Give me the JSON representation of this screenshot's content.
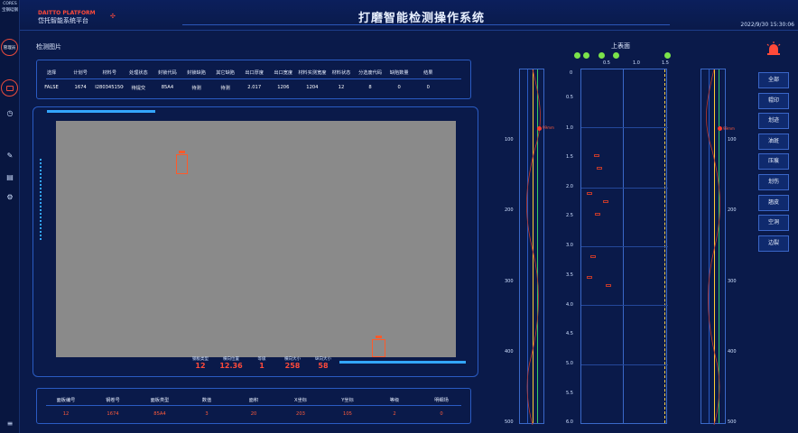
{
  "left_rail": {
    "logo_top": "CORES",
    "logo_bottom": "宝钢硅钢",
    "active_label": "管理员"
  },
  "header": {
    "brand_en": "DAITTO PLATFORM",
    "brand_cn": "岱托智能系统平台",
    "title": "打磨智能检测操作系统",
    "clock": "2022/9/30 15:30:06"
  },
  "image_section": {
    "title": "检测图片"
  },
  "material_table": {
    "columns": [
      "选择",
      "计划号",
      "材料号",
      "处理状态",
      "封锁代码",
      "封锁缺陷",
      "其它缺陷",
      "出口厚度",
      "出口宽度",
      "材料实测宽度",
      "材料状态",
      "分选废代码",
      "缺陷数量",
      "结果"
    ],
    "row": [
      "FALSE",
      "1674",
      "I2803451500",
      "待提交",
      "85A4",
      "待测",
      "待测",
      "2.017",
      "1206",
      "1204",
      "12",
      "8",
      "0",
      "0"
    ]
  },
  "readout": {
    "items": [
      {
        "label": "钢板类型",
        "value": "12"
      },
      {
        "label": "横向位置",
        "value": "12.36"
      },
      {
        "label": "等级",
        "value": "1"
      },
      {
        "label": "横向大小",
        "value": "258"
      },
      {
        "label": "纵向大小",
        "value": "58"
      }
    ]
  },
  "defect_table": {
    "columns": [
      "面板编号",
      "钢卷号",
      "面板类型",
      "数值",
      "面积",
      "X坐标",
      "Y坐标",
      "等级",
      "明细场"
    ],
    "row": [
      "12",
      "1674",
      "85A4",
      "3",
      "20",
      "203",
      "105",
      "2",
      "0"
    ]
  },
  "surface_chart": {
    "title": "上表面",
    "x_ticks": [
      "0.5",
      "1.0",
      "1.5"
    ],
    "y_ticks": [
      "0.5",
      "1.0",
      "1.5",
      "2.0",
      "2.5",
      "3.0",
      "3.5",
      "4.0",
      "4.5",
      "5.0",
      "5.5",
      "6.0"
    ],
    "y_zero": "0"
  },
  "side_strips": {
    "ticks": [
      "100",
      "200",
      "300",
      "400",
      "500"
    ],
    "marker_label": "99mm"
  },
  "filter_buttons": [
    "全部",
    "辊印",
    "划迹",
    "油斑",
    "压痕",
    "划伤",
    "翘皮",
    "空洞",
    "边裂"
  ],
  "colors": {
    "background": "#0a1a4a",
    "accent": "#2a5bc2",
    "alert": "#ff4a3a",
    "defect": "#ff5a2a"
  }
}
